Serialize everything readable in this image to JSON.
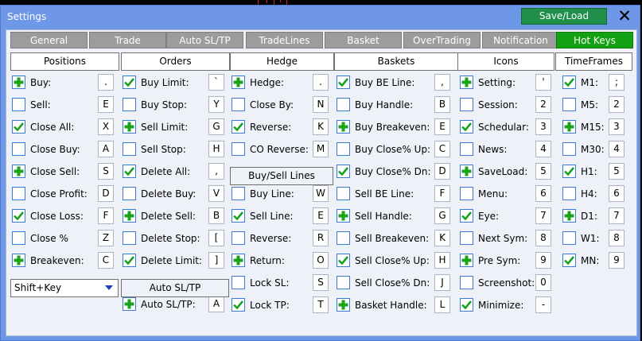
{
  "window": {
    "title": "Settings",
    "save_load": "Save/Load",
    "close": "✕"
  },
  "tabs": [
    "General",
    "Trade",
    "Auto SL/TP",
    "TradeLines",
    "Basket",
    "OverTrading",
    "Notification",
    "Hot Keys"
  ],
  "active_tab": "Hot Keys",
  "headers": [
    "Positions",
    "Orders",
    "Hedge",
    "Baskets",
    "Icons",
    "TimeFrames"
  ],
  "colors": {
    "checked_plus": "#1aa31a",
    "checked_tick": "#1aa31a",
    "checkbox_border": "#3a7bd5",
    "tab_active": "#11a112"
  },
  "positions": [
    {
      "label": "Buy:",
      "state": "plus",
      "key": "."
    },
    {
      "label": "Sell:",
      "state": "empty",
      "key": "E"
    },
    {
      "label": "Close All:",
      "state": "check",
      "key": "X"
    },
    {
      "label": "Close Buy:",
      "state": "empty",
      "key": "A"
    },
    {
      "label": "Close Sell:",
      "state": "plus",
      "key": "S"
    },
    {
      "label": "Close Profit:",
      "state": "empty",
      "key": "D"
    },
    {
      "label": "Close Loss:",
      "state": "check",
      "key": "F"
    },
    {
      "label": "Close %",
      "state": "empty",
      "key": "Z"
    },
    {
      "label": "Breakeven:",
      "state": "plus",
      "key": "C"
    }
  ],
  "modifier": {
    "value": "Shift+Key"
  },
  "orders": [
    {
      "label": "Buy Limit:",
      "state": "check",
      "key": "`"
    },
    {
      "label": "Buy Stop:",
      "state": "empty",
      "key": "Y"
    },
    {
      "label": "Sell Limit:",
      "state": "plus",
      "key": "G"
    },
    {
      "label": "Sell Stop:",
      "state": "empty",
      "key": "H"
    },
    {
      "label": "Delete All:",
      "state": "check",
      "key": ","
    },
    {
      "label": "Delete Buy:",
      "state": "empty",
      "key": "V"
    },
    {
      "label": "Delete Sell:",
      "state": "plus",
      "key": "B"
    },
    {
      "label": "Delete Stop:",
      "state": "empty",
      "key": "["
    },
    {
      "label": "Delete Limit:",
      "state": "check",
      "key": "]"
    }
  ],
  "auto_sltp": {
    "button": "Auto SL/TP",
    "label": "Auto SL/TP:",
    "state": "plus",
    "key": "A"
  },
  "hedge": [
    {
      "label": "Hedge:",
      "state": "plus",
      "key": "."
    },
    {
      "label": "Close By:",
      "state": "empty",
      "key": "N"
    },
    {
      "label": "Reverse:",
      "state": "check",
      "key": "K"
    },
    {
      "label": "CO Reverse:",
      "state": "empty",
      "key": "M"
    }
  ],
  "buysell_lines": {
    "button": "Buy/Sell Lines",
    "items": [
      {
        "label": "Buy Line:",
        "state": "empty",
        "key": "W"
      },
      {
        "label": "Sell Line:",
        "state": "check",
        "key": "E"
      },
      {
        "label": "Reverse:",
        "state": "empty",
        "key": "R"
      },
      {
        "label": "Return:",
        "state": "plus",
        "key": "O"
      },
      {
        "label": "Lock SL:",
        "state": "empty",
        "key": "S"
      },
      {
        "label": "Lock TP:",
        "state": "check",
        "key": "T"
      }
    ]
  },
  "baskets": [
    {
      "label": "Buy BE Line:",
      "state": "check",
      "key": ","
    },
    {
      "label": "Buy Handle:",
      "state": "empty",
      "key": "B"
    },
    {
      "label": "Buy Breakeven:",
      "state": "plus",
      "key": "E"
    },
    {
      "label": "Buy Close% Up:",
      "state": "empty",
      "key": "C"
    },
    {
      "label": "Buy Close% Dn:",
      "state": "check",
      "key": "D"
    },
    {
      "label": "Sell BE Line:",
      "state": "empty",
      "key": "F"
    },
    {
      "label": "Sell Handle:",
      "state": "plus",
      "key": "G"
    },
    {
      "label": "Sell Breakeven:",
      "state": "empty",
      "key": "K"
    },
    {
      "label": "Sell Close% Up:",
      "state": "check",
      "key": "H"
    },
    {
      "label": "Sell Close% Dn:",
      "state": "empty",
      "key": "J"
    },
    {
      "label": "Basket Handle:",
      "state": "plus",
      "key": "L"
    }
  ],
  "icons": [
    {
      "label": "Setting:",
      "state": "plus",
      "key": "'"
    },
    {
      "label": "Session:",
      "state": "empty",
      "key": "2"
    },
    {
      "label": "Schedular:",
      "state": "check",
      "key": "3"
    },
    {
      "label": "News:",
      "state": "empty",
      "key": "4"
    },
    {
      "label": "SaveLoad:",
      "state": "plus",
      "key": "5"
    },
    {
      "label": "Menu:",
      "state": "empty",
      "key": "6"
    },
    {
      "label": "Eye:",
      "state": "check",
      "key": "7"
    },
    {
      "label": "Next Sym:",
      "state": "empty",
      "key": "8"
    },
    {
      "label": "Pre Sym:",
      "state": "plus",
      "key": "9"
    },
    {
      "label": "Screenshot:",
      "state": "empty",
      "key": "0"
    },
    {
      "label": "Minimize:",
      "state": "check",
      "key": "-"
    }
  ],
  "timeframes": [
    {
      "label": "M1:",
      "state": "check",
      "key": ";"
    },
    {
      "label": "M5:",
      "state": "empty",
      "key": "2"
    },
    {
      "label": "M15:",
      "state": "plus",
      "key": "3"
    },
    {
      "label": "M30:",
      "state": "empty",
      "key": "4"
    },
    {
      "label": "H1:",
      "state": "check",
      "key": "5"
    },
    {
      "label": "H4:",
      "state": "empty",
      "key": "6"
    },
    {
      "label": "D1:",
      "state": "plus",
      "key": "7"
    },
    {
      "label": "W1:",
      "state": "empty",
      "key": "8"
    },
    {
      "label": "MN:",
      "state": "check",
      "key": "9"
    }
  ]
}
